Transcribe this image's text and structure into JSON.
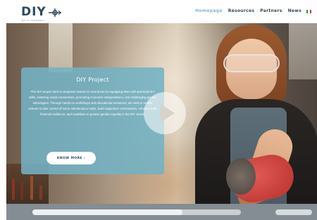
{
  "header": {
    "logo_text": "DIY",
    "logo_subtext": "DO IT YOURSELF",
    "nav": [
      {
        "label": "Homepage",
        "active": true
      },
      {
        "label": "Resources",
        "active": false
      },
      {
        "label": "Partners",
        "active": false
      },
      {
        "label": "News",
        "active": false
      }
    ],
    "language_flag": "italy-flag-icon"
  },
  "hero": {
    "card": {
      "title": "DIY Project",
      "body": "The DIY project aims to empower women in rural areas by equipping them with practical DIY skills, fostering social connections, promoting economic independence, and challenging gender stereotypes. Through hands-on workshops and educational resources, we seek to enable women to take control of home maintenance tasks, build supportive communities, enhance their financial resilience, and contribute to greater gender equality in the DIY sector.",
      "button_label": "KNOW MORE ›"
    },
    "play_icon": "play-icon"
  },
  "video_controls": {
    "progress": 0.72
  },
  "colors": {
    "accent": "#7fb6c6",
    "card_bg": "#73b2c4",
    "nav_text": "#2f4658"
  }
}
